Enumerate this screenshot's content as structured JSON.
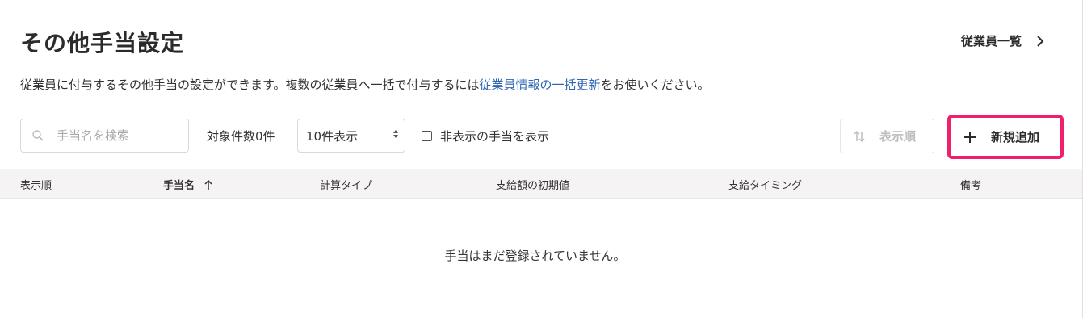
{
  "page": {
    "title": "その他手当設定",
    "employee_list_link": "従業員一覧",
    "description_before": "従業員に付与するその他手当の設定ができます。複数の従業員へ一括で付与するには",
    "description_link": "従業員情報の一括更新",
    "description_after": "をお使いください。"
  },
  "toolbar": {
    "search_placeholder": "手当名を検索",
    "search_value": "",
    "count_text": "対象件数0件",
    "per_page_selected": "10件表示",
    "show_hidden_label": "非表示の手当を表示",
    "show_hidden_checked": false,
    "sort_order_label": "表示順",
    "new_label": "新規追加"
  },
  "table": {
    "columns": [
      "表示順",
      "手当名",
      "計算タイプ",
      "支給額の初期値",
      "支給タイミング",
      "備考"
    ],
    "sorted_column": "手当名",
    "sort_direction": "asc",
    "empty_message": "手当はまだ登録されていません。"
  },
  "icons": {
    "search": "search-icon",
    "chevron": "chevron-right-icon",
    "sort": "sort-icon",
    "plus": "plus-icon",
    "sort_asc": "arrow-up-icon"
  },
  "colors": {
    "accent_border": "#ef1f6e",
    "link": "#2f66b3",
    "header_bg": "#f5f3f3"
  }
}
